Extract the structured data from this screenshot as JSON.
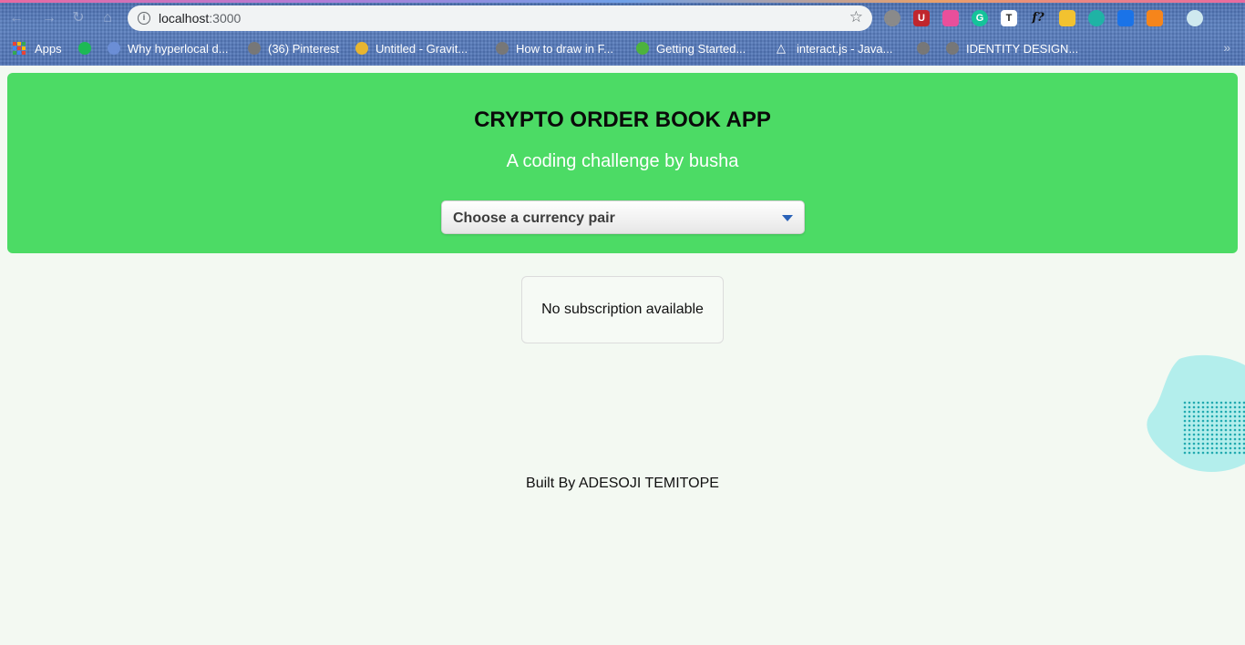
{
  "browser": {
    "url_host": "localhost",
    "url_port": ":3000",
    "bookmarks": [
      {
        "label": "Apps",
        "icon": "apps-grid-icon"
      },
      {
        "label": "",
        "icon": "spotify-icon",
        "color": "#1db954"
      },
      {
        "label": "Why hyperlocal d...",
        "icon": "page-icon",
        "color": "#6b8ed6"
      },
      {
        "label": "(36) Pinterest",
        "icon": "globe-icon",
        "color": "#777777"
      },
      {
        "label": "Untitled - Gravit...",
        "icon": "gravit-icon",
        "color": "#e8b530"
      },
      {
        "label": "How to draw in F...",
        "icon": "globe-icon",
        "color": "#777777"
      },
      {
        "label": "Getting Started...",
        "icon": "leaf-icon",
        "color": "#4db33d"
      },
      {
        "label": "interact.js - Java...",
        "icon": "triangle-icon",
        "color": "#ffffff"
      },
      {
        "label": "",
        "icon": "globe-icon",
        "color": "#777777"
      },
      {
        "label": "IDENTITY DESIGN...",
        "icon": "globe-icon",
        "color": "#777777"
      }
    ],
    "extensions": [
      {
        "icon": "shield-icon",
        "glyph": "",
        "color": "#8a8a8a"
      },
      {
        "icon": "ublock-icon",
        "glyph": "U",
        "color": "#c0262d"
      },
      {
        "icon": "colorpicker-icon",
        "glyph": "",
        "color": "#e94f9b"
      },
      {
        "icon": "grammarly-icon",
        "glyph": "G",
        "color": "#15c39a"
      },
      {
        "icon": "text-icon",
        "glyph": "T",
        "color": "#ffffff"
      },
      {
        "icon": "fonts-icon",
        "glyph": "f?",
        "color": "#222222"
      },
      {
        "icon": "palette-icon",
        "glyph": "",
        "color": "#f2c230"
      },
      {
        "icon": "refresh-ext-icon",
        "glyph": "",
        "color": "#1fb3a5"
      },
      {
        "icon": "share-icon",
        "glyph": "",
        "color": "#1a73e8"
      },
      {
        "icon": "fox-icon",
        "glyph": "",
        "color": "#f6851b"
      },
      {
        "icon": "avatar-icon",
        "glyph": "",
        "color": "#cfe9ef"
      }
    ]
  },
  "header": {
    "title": "CRYPTO ORDER BOOK APP",
    "subtitle": "A coding challenge by busha",
    "select_placeholder": "Choose a currency pair"
  },
  "main": {
    "empty_message": "No subscription available"
  },
  "footer": {
    "credit": "Built By ADESOJI TEMITOPE"
  },
  "colors": {
    "header_bg": "#4cdb65",
    "page_bg": "#f3f9f2",
    "blob": "#b3eeec",
    "dots": "#22aab0"
  }
}
